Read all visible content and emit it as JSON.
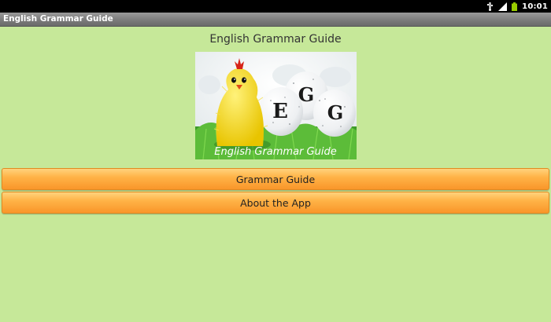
{
  "status_bar": {
    "time": "10:01",
    "icons": [
      "usb-icon",
      "wifi-icon",
      "battery-icon"
    ]
  },
  "title_bar": {
    "title": "English Grammar Guide"
  },
  "main": {
    "heading": "English Grammar Guide",
    "logo": {
      "letters": [
        "E",
        "G",
        "G"
      ],
      "banner": "English Grammar Guide"
    },
    "buttons": {
      "grammar_guide": "Grammar Guide",
      "about": "About the App"
    }
  },
  "colors": {
    "background": "#c6e899",
    "button_top": "#ffd27d",
    "button_bottom": "#f9962a",
    "title_bar": "#7c7c7c"
  }
}
